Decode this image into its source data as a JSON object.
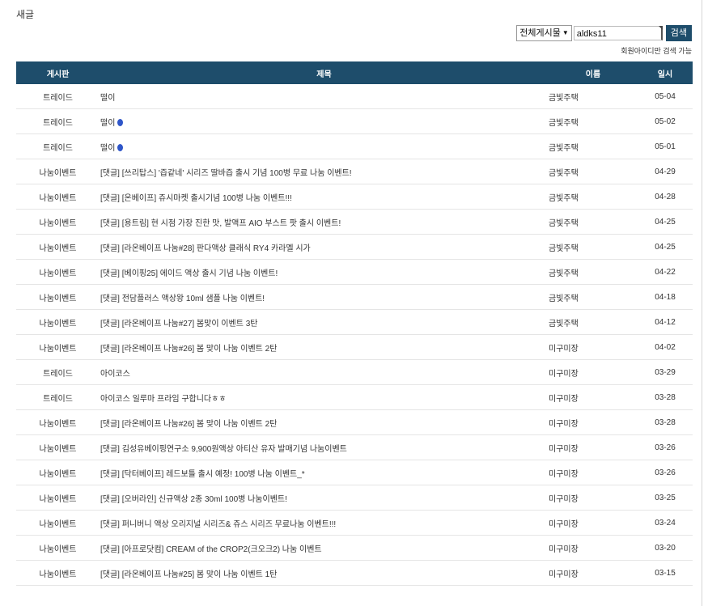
{
  "page": {
    "title": "새글"
  },
  "search": {
    "scope_selected": "전체게시물",
    "query": "aldks11",
    "button_label": "검색",
    "hint": "회원아이디만 검색 가능"
  },
  "table": {
    "headers": {
      "board": "게시판",
      "title": "제목",
      "name": "이름",
      "date": "일시"
    },
    "rows": [
      {
        "board": "트레이드",
        "title": "떨이",
        "name": "금빛주택",
        "date": "05-04",
        "icon": false
      },
      {
        "board": "트레이드",
        "title": "떨이",
        "name": "금빛주택",
        "date": "05-02",
        "icon": true
      },
      {
        "board": "트레이드",
        "title": "떨이",
        "name": "금빛주택",
        "date": "05-01",
        "icon": true
      },
      {
        "board": "나눔이벤트",
        "title": "[댓글] [쓰리탑스] '즙같네' 시리즈 딸바즙 출시 기념 100병 무료 나눔 이벤트!",
        "name": "금빛주택",
        "date": "04-29",
        "icon": false
      },
      {
        "board": "나눔이벤트",
        "title": "[댓글] [온베이프] 쥬시마켓 출시기념 100병 나눔 이벤트!!!",
        "name": "금빛주택",
        "date": "04-28",
        "icon": false
      },
      {
        "board": "나눔이벤트",
        "title": "[댓글] [용트림] 현 시점 가장 진한 맛, 발액프 AIO 부스트 팟 출시 이벤트!",
        "name": "금빛주택",
        "date": "04-25",
        "icon": false
      },
      {
        "board": "나눔이벤트",
        "title": "[댓글] [라온베이프 나눔#28] 판다액상 클래식 RY4 카라멜 시가",
        "name": "금빛주택",
        "date": "04-25",
        "icon": false
      },
      {
        "board": "나눔이벤트",
        "title": "[댓글] [베이핑25] 에이드 액상 출시 기념 나눔 이벤트!",
        "name": "금빛주택",
        "date": "04-22",
        "icon": false
      },
      {
        "board": "나눔이벤트",
        "title": "[댓글] 전담플러스 액상왕 10ml 샘플 나눔 이벤트!",
        "name": "금빛주택",
        "date": "04-18",
        "icon": false
      },
      {
        "board": "나눔이벤트",
        "title": "[댓글] [라온베이프 나눔#27] 봄맞이 이벤트 3탄",
        "name": "금빛주택",
        "date": "04-12",
        "icon": false
      },
      {
        "board": "나눔이벤트",
        "title": "[댓글] [라온베이프 나눔#26] 봄 맞이 나눔 이벤트 2탄",
        "name": "미구미장",
        "date": "04-02",
        "icon": false
      },
      {
        "board": "트레이드",
        "title": "아이코스",
        "name": "미구미장",
        "date": "03-29",
        "icon": false
      },
      {
        "board": "트레이드",
        "title": "아이코스 일루마 프라임 구합니다ㅎㅎ",
        "name": "미구미장",
        "date": "03-28",
        "icon": false
      },
      {
        "board": "나눔이벤트",
        "title": "[댓글] [라온베이프 나눔#26] 봄 맞이 나눔 이벤트 2탄",
        "name": "미구미장",
        "date": "03-28",
        "icon": false
      },
      {
        "board": "나눔이벤트",
        "title": "[댓글] 김성유베이핑연구소 9,900원액상 아티산 유자 발매기념 나눔이벤트",
        "name": "미구미장",
        "date": "03-26",
        "icon": false
      },
      {
        "board": "나눔이벤트",
        "title": "[댓글] [닥터베이프] 레드보틀 출시 예정! 100병 나눔 이벤트_*",
        "name": "미구미장",
        "date": "03-26",
        "icon": false
      },
      {
        "board": "나눔이벤트",
        "title": "[댓글] [오버라인] 신규액상 2종 30ml 100병 나눔이벤트!",
        "name": "미구미장",
        "date": "03-25",
        "icon": false
      },
      {
        "board": "나눔이벤트",
        "title": "[댓글] 퍼니버니 액상 오리지널 시리즈& 쥬스 시리즈 무료나눔 이벤트!!!",
        "name": "미구미장",
        "date": "03-24",
        "icon": false
      },
      {
        "board": "나눔이벤트",
        "title": "[댓글] [아프로닷컴] CREAM of the CROP2(크오크2) 나눔 이벤트",
        "name": "미구미장",
        "date": "03-20",
        "icon": false
      },
      {
        "board": "나눔이벤트",
        "title": "[댓글] [라온베이프 나눔#25] 봄 맞이 나눔 이벤트 1탄",
        "name": "미구미장",
        "date": "03-15",
        "icon": false
      }
    ]
  },
  "colors": {
    "header_bg": "#1e4d6b",
    "button_bg": "#1e4d6b",
    "row_border": "#e5e5e5"
  }
}
